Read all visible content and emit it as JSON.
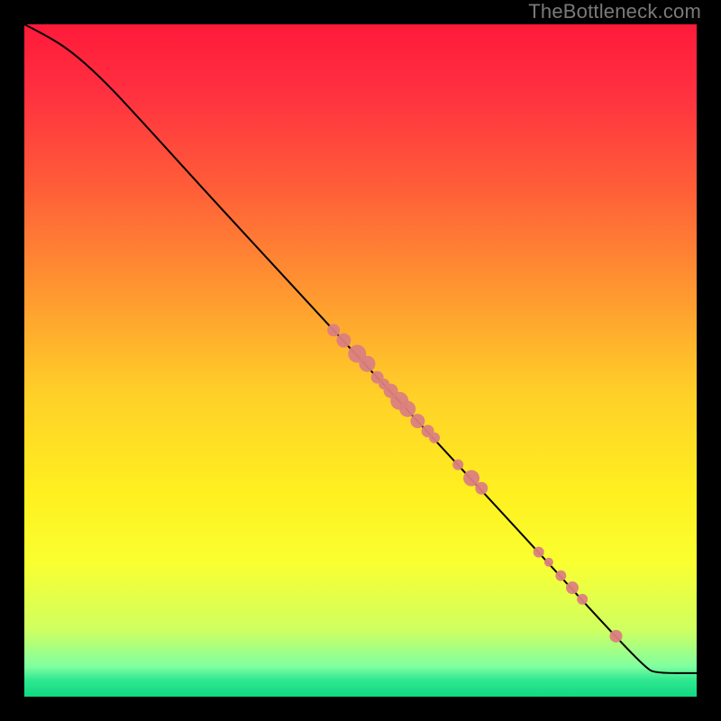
{
  "watermark": "TheBottleneck.com",
  "colors": {
    "point_fill": "#db8080",
    "curve_stroke": "#000000",
    "frame_bg": "#000000"
  },
  "chart_data": {
    "type": "scatter",
    "title": "",
    "xlabel": "",
    "ylabel": "",
    "xlim": [
      0,
      100
    ],
    "ylim": [
      0,
      100
    ],
    "gradient_stops": [
      {
        "offset": 0.0,
        "color": "#ff1a3a"
      },
      {
        "offset": 0.1,
        "color": "#ff3040"
      },
      {
        "offset": 0.25,
        "color": "#ff6038"
      },
      {
        "offset": 0.4,
        "color": "#ff9830"
      },
      {
        "offset": 0.55,
        "color": "#ffd028"
      },
      {
        "offset": 0.7,
        "color": "#fff020"
      },
      {
        "offset": 0.8,
        "color": "#faff30"
      },
      {
        "offset": 0.9,
        "color": "#d0ff60"
      },
      {
        "offset": 0.955,
        "color": "#80ffa0"
      },
      {
        "offset": 0.975,
        "color": "#30e890"
      },
      {
        "offset": 1.0,
        "color": "#10d880"
      }
    ],
    "curve": [
      {
        "x": 0,
        "y": 100
      },
      {
        "x": 3,
        "y": 98.5
      },
      {
        "x": 7,
        "y": 96
      },
      {
        "x": 12,
        "y": 91.5
      },
      {
        "x": 18,
        "y": 85
      },
      {
        "x": 28,
        "y": 74
      },
      {
        "x": 40,
        "y": 61
      },
      {
        "x": 52,
        "y": 48
      },
      {
        "x": 64,
        "y": 35
      },
      {
        "x": 76,
        "y": 22
      },
      {
        "x": 86,
        "y": 11
      },
      {
        "x": 92.5,
        "y": 4.2
      },
      {
        "x": 94,
        "y": 3.5
      },
      {
        "x": 100,
        "y": 3.5
      }
    ],
    "points": [
      {
        "x": 46.0,
        "y": 54.5,
        "r": 7
      },
      {
        "x": 47.5,
        "y": 53.0,
        "r": 8
      },
      {
        "x": 49.5,
        "y": 51.0,
        "r": 10
      },
      {
        "x": 51.0,
        "y": 49.5,
        "r": 9
      },
      {
        "x": 52.5,
        "y": 47.5,
        "r": 7
      },
      {
        "x": 53.5,
        "y": 46.5,
        "r": 6
      },
      {
        "x": 54.5,
        "y": 45.5,
        "r": 8
      },
      {
        "x": 55.8,
        "y": 44.0,
        "r": 10
      },
      {
        "x": 57.0,
        "y": 42.8,
        "r": 9
      },
      {
        "x": 58.5,
        "y": 41.0,
        "r": 8
      },
      {
        "x": 60.0,
        "y": 39.5,
        "r": 7
      },
      {
        "x": 61.0,
        "y": 38.5,
        "r": 6
      },
      {
        "x": 64.5,
        "y": 34.5,
        "r": 6
      },
      {
        "x": 66.5,
        "y": 32.5,
        "r": 9
      },
      {
        "x": 68.0,
        "y": 31.0,
        "r": 7
      },
      {
        "x": 76.5,
        "y": 21.5,
        "r": 6
      },
      {
        "x": 78.0,
        "y": 20.0,
        "r": 5
      },
      {
        "x": 79.8,
        "y": 18.0,
        "r": 6
      },
      {
        "x": 81.5,
        "y": 16.2,
        "r": 7
      },
      {
        "x": 83.0,
        "y": 14.5,
        "r": 6
      },
      {
        "x": 88.0,
        "y": 9.0,
        "r": 7
      }
    ]
  }
}
